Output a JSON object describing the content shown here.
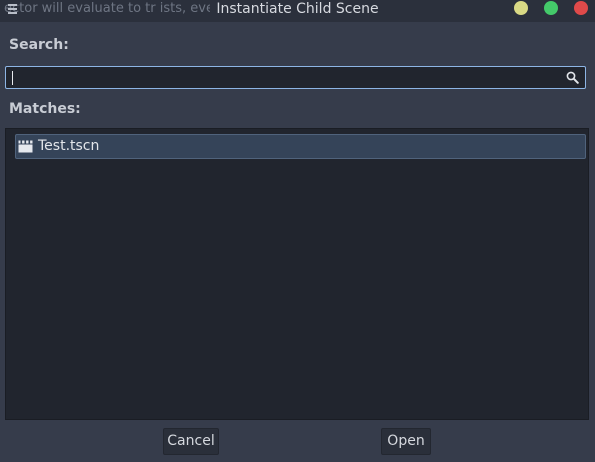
{
  "window": {
    "title": "Instantiate Child Scene",
    "background_text": "ector will evaluate to tr                        ists, even if the value is null"
  },
  "search": {
    "label": "Search:",
    "value": "",
    "placeholder": ""
  },
  "matches": {
    "label": "Matches:",
    "items": [
      {
        "label": "Test.tscn",
        "icon": "scene-icon",
        "selected": true
      }
    ]
  },
  "buttons": {
    "cancel_label": "Cancel",
    "open_label": "Open"
  },
  "colors": {
    "accent": "#8db5e5",
    "selection": "#354459",
    "panel": "#21252e",
    "window": "#363c4b",
    "minimize": "#d9d985",
    "maximize": "#44c96a",
    "close": "#e04a4a"
  },
  "icons": {
    "menu": "menu-icon",
    "search": "search-icon",
    "scene": "scene-icon"
  }
}
